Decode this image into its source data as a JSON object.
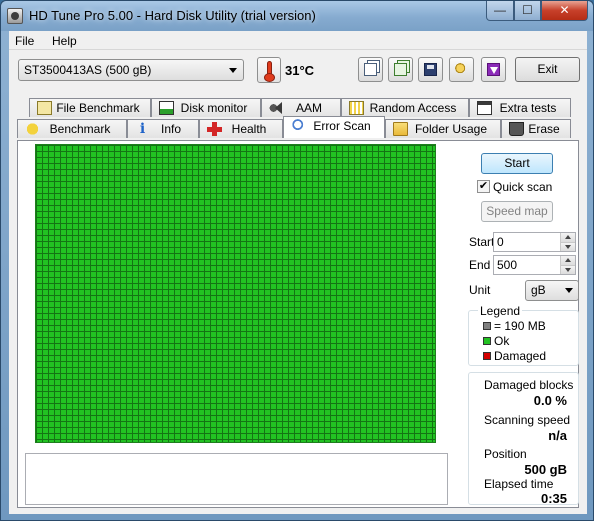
{
  "window": {
    "title": "HD Tune Pro 5.00 - Hard Disk Utility (trial version)",
    "controls": {
      "minimize": "—",
      "maximize": "☐",
      "close": "✕"
    }
  },
  "menu": {
    "file": "File",
    "help": "Help"
  },
  "toolbar": {
    "drive": "ST3500413AS (500 gB)",
    "temperature": "31°C",
    "exit_label": "Exit",
    "icons": [
      "copy-text-icon",
      "copy-screenshot-icon",
      "save-icon",
      "options-icon",
      "download-icon"
    ]
  },
  "tabs": {
    "row1": [
      "File Benchmark",
      "Disk monitor",
      "AAM",
      "Random Access",
      "Extra tests"
    ],
    "row2": [
      "Benchmark",
      "Info",
      "Health",
      "Error Scan",
      "Folder Usage",
      "Erase"
    ],
    "active": "Error Scan"
  },
  "error_scan": {
    "start_label": "Start",
    "quick_scan_label": "Quick scan",
    "quick_scan_checked": true,
    "speed_map_label": "Speed map",
    "start_field_label": "Start",
    "start_value": "0",
    "end_field_label": "End",
    "end_value": "500",
    "unit_label": "Unit",
    "unit_value": "gB",
    "block_status": "all-ok",
    "legend": {
      "title": "Legend",
      "items": [
        {
          "label": "= 190 MB",
          "color": "#808080"
        },
        {
          "label": "Ok",
          "color": "#22c222"
        },
        {
          "label": "Damaged",
          "color": "#d40000"
        }
      ]
    },
    "stats": {
      "damaged_blocks_label": "Damaged blocks",
      "damaged_blocks_value": "0.0 %",
      "scanning_speed_label": "Scanning speed",
      "scanning_speed_value": "n/a",
      "position_label": "Position",
      "position_value": "500 gB",
      "elapsed_time_label": "Elapsed time",
      "elapsed_time_value": "0:35"
    }
  },
  "colors": {
    "ok_block": "#22c222",
    "grid_line": "#147414",
    "damaged": "#d40000"
  }
}
